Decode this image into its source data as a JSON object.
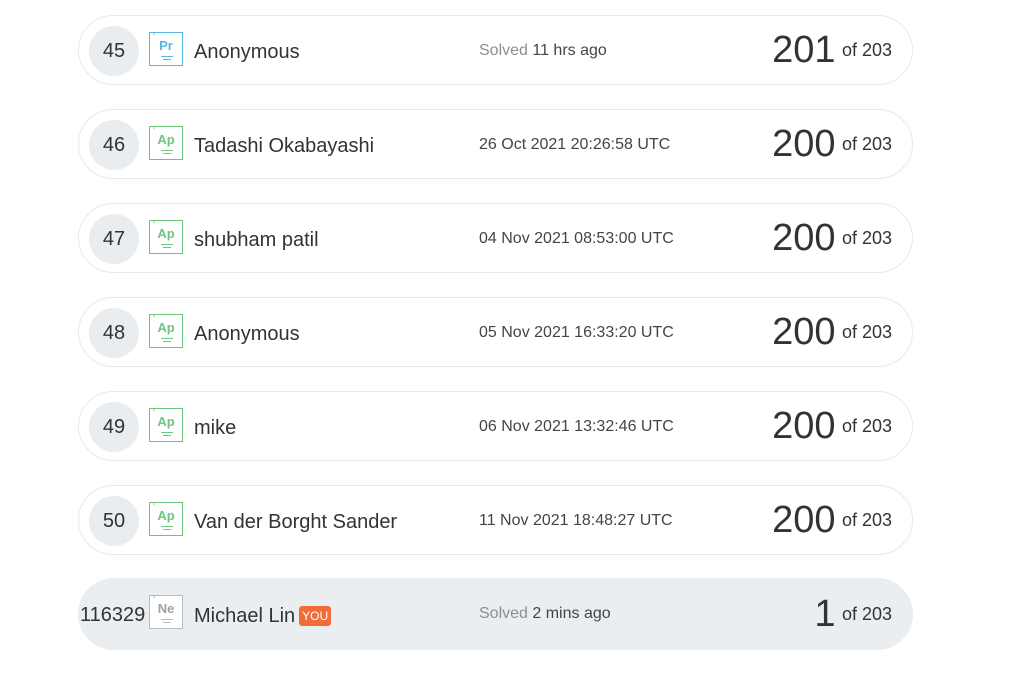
{
  "leaderboard": {
    "rows": [
      {
        "rank": "45",
        "badge": "Pr",
        "badge_color": "#5bb8e6",
        "name": "Anonymous",
        "time_prefix": "Solved",
        "time": "11 hrs ago",
        "score": "201",
        "of_label": "of 203"
      },
      {
        "rank": "46",
        "badge": "Ap",
        "badge_color": "#6cc77a",
        "name": "Tadashi Okabayashi",
        "time_prefix": "",
        "time": "26 Oct 2021 20:26:58 UTC",
        "score": "200",
        "of_label": "of 203"
      },
      {
        "rank": "47",
        "badge": "Ap",
        "badge_color": "#6cc77a",
        "name": "shubham patil",
        "time_prefix": "",
        "time": "04 Nov 2021 08:53:00 UTC",
        "score": "200",
        "of_label": "of 203"
      },
      {
        "rank": "48",
        "badge": "Ap",
        "badge_color": "#6cc77a",
        "name": "Anonymous",
        "time_prefix": "",
        "time": "05 Nov 2021 16:33:20 UTC",
        "score": "200",
        "of_label": "of 203"
      },
      {
        "rank": "49",
        "badge": "Ap",
        "badge_color": "#6cc77a",
        "name": "mike",
        "time_prefix": "",
        "time": "06 Nov 2021 13:32:46 UTC",
        "score": "200",
        "of_label": "of 203"
      },
      {
        "rank": "50",
        "badge": "Ap",
        "badge_color": "#6cc77a",
        "name": "Van der Borght Sander",
        "time_prefix": "",
        "time": "11 Nov 2021 18:48:27 UTC",
        "score": "200",
        "of_label": "of 203"
      }
    ],
    "current_user": {
      "rank": "116329",
      "badge": "Ne",
      "badge_color": "#9aa0a5",
      "name": "Michael Lin",
      "you_tag": "YOU",
      "you_tag_color": "#f26c3a",
      "time_prefix": "Solved",
      "time": "2 mins ago",
      "score": "1",
      "of_label": "of 203"
    }
  }
}
